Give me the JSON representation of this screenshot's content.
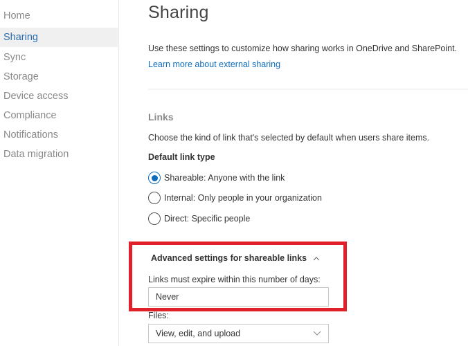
{
  "sidebar": {
    "items": [
      {
        "label": "Home",
        "selected": false
      },
      {
        "label": "Sharing",
        "selected": true
      },
      {
        "label": "Sync",
        "selected": false
      },
      {
        "label": "Storage",
        "selected": false
      },
      {
        "label": "Device access",
        "selected": false
      },
      {
        "label": "Compliance",
        "selected": false
      },
      {
        "label": "Notifications",
        "selected": false
      },
      {
        "label": "Data migration",
        "selected": false
      }
    ]
  },
  "main": {
    "title": "Sharing",
    "intro": "Use these settings to customize how sharing works in OneDrive and SharePoint.",
    "learn_more_link": "Learn more about external sharing",
    "links_section": {
      "title": "Links",
      "description": "Choose the kind of link that's selected by default when users share items.",
      "default_link_type_heading": "Default link type",
      "options": [
        {
          "label": "Shareable: Anyone with the link",
          "checked": true
        },
        {
          "label": "Internal: Only people in your organization",
          "checked": false
        },
        {
          "label": "Direct: Specific people",
          "checked": false
        }
      ]
    },
    "advanced": {
      "header": "Advanced settings for shareable links",
      "expanded": true,
      "expire_label": "Links must expire within this number of days:",
      "expire_value": "Never",
      "files_label": "Files:",
      "files_value": "View, edit, and upload"
    }
  },
  "colors": {
    "accent": "#0f6cbd",
    "highlight_box": "#e0202a",
    "selected_nav_bg": "#f0f0f0"
  }
}
